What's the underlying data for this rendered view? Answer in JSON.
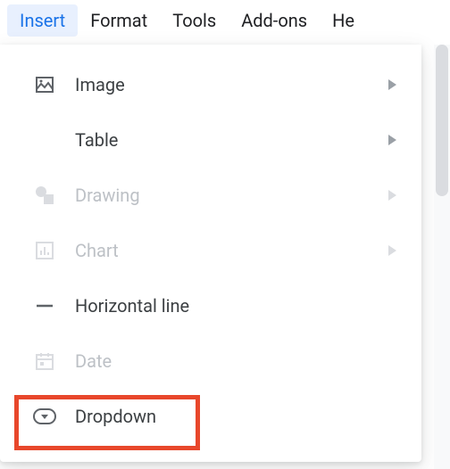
{
  "menubar": {
    "items": [
      "Insert",
      "Format",
      "Tools",
      "Add-ons",
      "He"
    ],
    "active_index": 0
  },
  "menu": {
    "items": [
      {
        "label": "Image",
        "has_submenu": true,
        "disabled": false
      },
      {
        "label": "Table",
        "has_submenu": true,
        "disabled": false
      },
      {
        "label": "Drawing",
        "has_submenu": true,
        "disabled": true
      },
      {
        "label": "Chart",
        "has_submenu": true,
        "disabled": true
      },
      {
        "label": "Horizontal line",
        "has_submenu": false,
        "disabled": false
      },
      {
        "label": "Date",
        "has_submenu": false,
        "disabled": true
      },
      {
        "label": "Dropdown",
        "has_submenu": false,
        "disabled": false
      }
    ]
  },
  "highlight": {
    "target_label": "Dropdown"
  }
}
